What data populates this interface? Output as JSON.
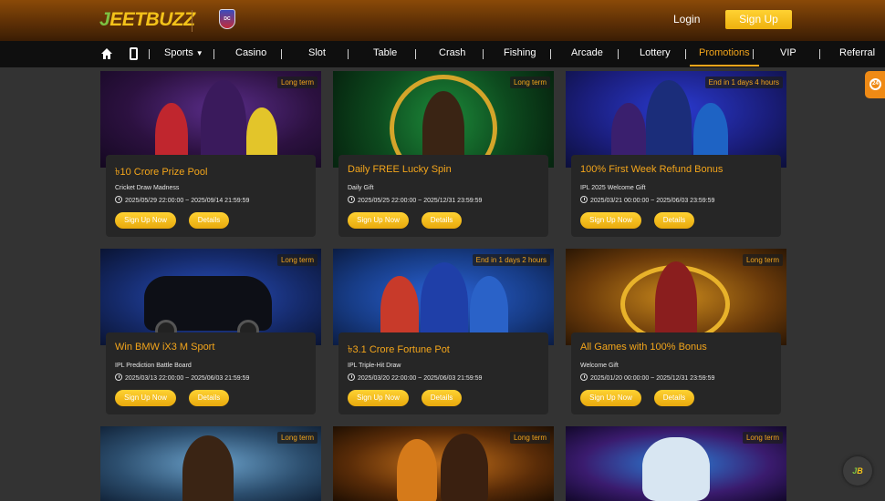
{
  "header": {
    "logo_prefix": "J",
    "logo_rest": "EETBUZZ",
    "team_badge": "DC",
    "login_label": "Login",
    "signup_label": "Sign Up"
  },
  "nav": {
    "items": [
      "Sports",
      "Casino",
      "Slot",
      "Table",
      "Crash",
      "Fishing",
      "Arcade",
      "Lottery",
      "Promotions",
      "VIP",
      "Referral"
    ],
    "active": "Promotions"
  },
  "side_widget": {
    "label": "24"
  },
  "float_button": {
    "prefix": "J",
    "rest": "B"
  },
  "promos": [
    {
      "tag": "Long term",
      "title": "৳10 Crore Prize Pool",
      "subtitle": "Cricket Draw Madness",
      "dates": "2025/05/29 22:00:00 ~ 2025/09/14 21:59:59",
      "signup": "Sign Up Now",
      "details": "Details"
    },
    {
      "tag": "Long term",
      "title": "Daily FREE Lucky Spin",
      "subtitle": "Daily Gift",
      "dates": "2025/05/25 22:00:00 ~ 2025/12/31 23:59:59",
      "signup": "Sign Up Now",
      "details": "Details"
    },
    {
      "tag": "End in 1 days 4 hours",
      "title": "100% First Week Refund Bonus",
      "subtitle": "IPL 2025 Welcome Gift",
      "dates": "2025/03/21 00:00:00 ~ 2025/06/03 23:59:59",
      "signup": "Sign Up Now",
      "details": "Details"
    },
    {
      "tag": "Long term",
      "title": "Win BMW iX3 M Sport",
      "subtitle": "IPL Prediction Battle Board",
      "dates": "2025/03/13 22:00:00 ~ 2025/06/03 21:59:59",
      "signup": "Sign Up Now",
      "details": "Details"
    },
    {
      "tag": "End in 1 days 2 hours",
      "title": "৳3.1 Crore Fortune Pot",
      "subtitle": "IPL Triple-Hit Draw",
      "dates": "2025/03/20 22:00:00 ~ 2025/06/03 21:59:59",
      "signup": "Sign Up Now",
      "details": "Details"
    },
    {
      "tag": "Long term",
      "title": "All Games with 100% Bonus",
      "subtitle": "Welcome Gift",
      "dates": "2025/01/20 00:00:00 ~ 2025/12/31 23:59:59",
      "signup": "Sign Up Now",
      "details": "Details"
    },
    {
      "tag": "Long term"
    },
    {
      "tag": "Long term"
    },
    {
      "tag": "Long term"
    }
  ],
  "colors": {
    "accent": "#f3a51b",
    "button": "#f5c21b",
    "panel": "#262626",
    "page_bg": "#333333"
  }
}
